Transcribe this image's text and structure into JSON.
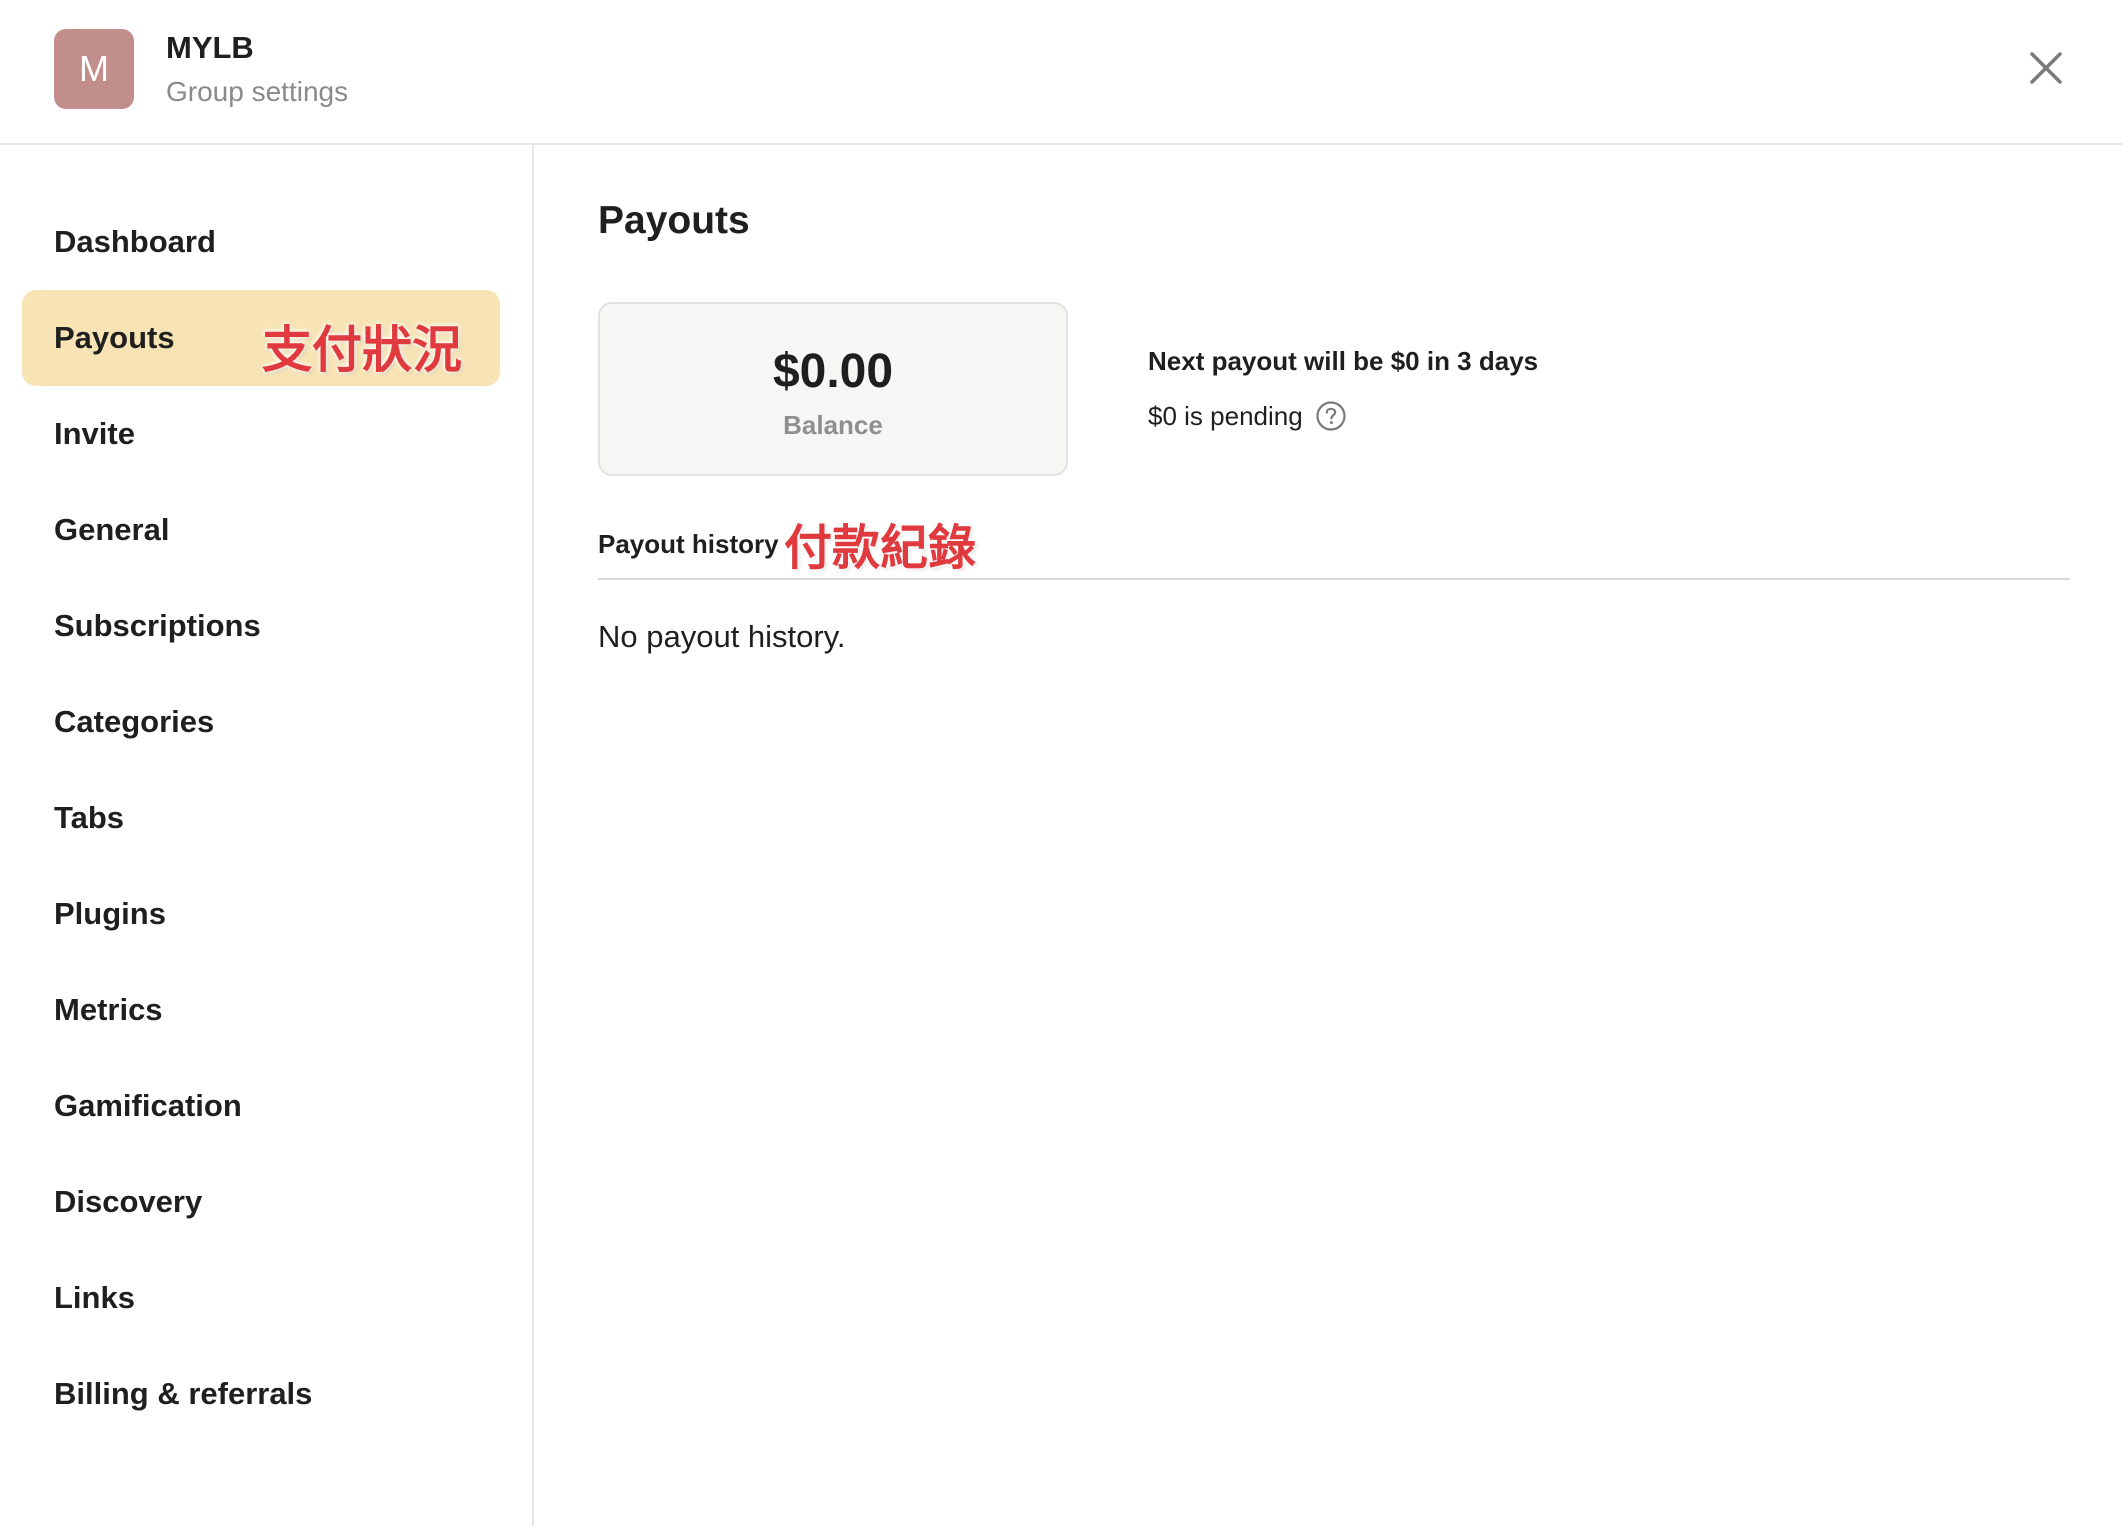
{
  "header": {
    "avatar_letter": "M",
    "group_name": "MYLB",
    "subtitle": "Group settings",
    "close_icon": "close-icon"
  },
  "sidebar": {
    "items": [
      {
        "label": "Dashboard"
      },
      {
        "label": "Payouts",
        "active": true
      },
      {
        "label": "Invite"
      },
      {
        "label": "General"
      },
      {
        "label": "Subscriptions"
      },
      {
        "label": "Categories"
      },
      {
        "label": "Tabs"
      },
      {
        "label": "Plugins"
      },
      {
        "label": "Metrics"
      },
      {
        "label": "Gamification"
      },
      {
        "label": "Discovery"
      },
      {
        "label": "Links"
      },
      {
        "label": "Billing & referrals"
      }
    ],
    "annotation": "支付狀況"
  },
  "main": {
    "title": "Payouts",
    "balance": {
      "amount": "$0.00",
      "label": "Balance"
    },
    "next_payout": "Next payout will be $0 in 3 days",
    "pending": "$0 is pending",
    "help_icon": "question-circle-icon",
    "history_label": "Payout history",
    "history_annotation": "付款紀錄",
    "empty_message": "No payout history."
  },
  "colors": {
    "avatar_bg": "#c28e8b",
    "active_item_bg": "#f7e3b3",
    "annotation_red": "#e0393e",
    "card_bg": "#f6f6f4"
  }
}
